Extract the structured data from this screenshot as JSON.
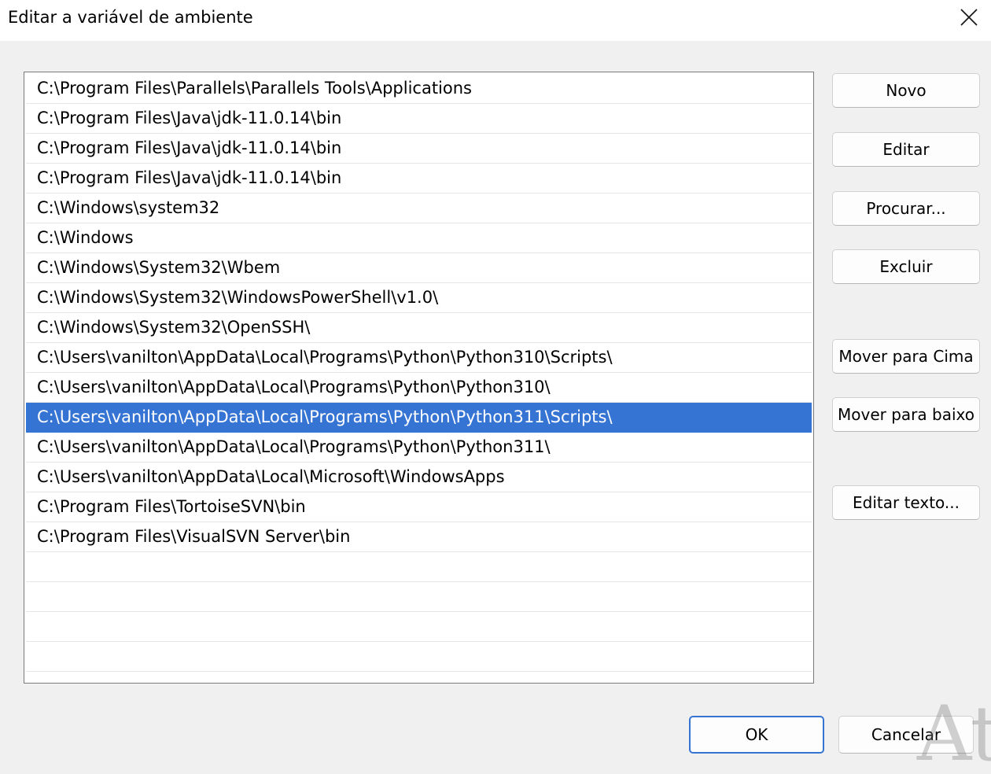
{
  "window": {
    "title": "Editar a variável de ambiente",
    "close_icon": "close-icon"
  },
  "paths": [
    "C:\\Program Files\\Parallels\\Parallels Tools\\Applications",
    "C:\\Program Files\\Java\\jdk-11.0.14\\bin",
    "C:\\Program Files\\Java\\jdk-11.0.14\\bin",
    "C:\\Program Files\\Java\\jdk-11.0.14\\bin",
    "C:\\Windows\\system32",
    "C:\\Windows",
    "C:\\Windows\\System32\\Wbem",
    "C:\\Windows\\System32\\WindowsPowerShell\\v1.0\\",
    "C:\\Windows\\System32\\OpenSSH\\",
    "C:\\Users\\vanilton\\AppData\\Local\\Programs\\Python\\Python310\\Scripts\\",
    "C:\\Users\\vanilton\\AppData\\Local\\Programs\\Python\\Python310\\",
    "C:\\Users\\vanilton\\AppData\\Local\\Programs\\Python\\Python311\\Scripts\\",
    "C:\\Users\\vanilton\\AppData\\Local\\Programs\\Python\\Python311\\",
    "C:\\Users\\vanilton\\AppData\\Local\\Microsoft\\WindowsApps",
    "C:\\Program Files\\TortoiseSVN\\bin",
    "C:\\Program Files\\VisualSVN Server\\bin",
    "",
    "",
    "",
    "",
    ""
  ],
  "selected_index": 11,
  "colors": {
    "selection": "#3574d3",
    "background": "#f0f0f0"
  },
  "buttons": {
    "new": "Novo",
    "edit": "Editar",
    "browse": "Procurar...",
    "delete": "Excluir",
    "move_up": "Mover para Cima",
    "move_down": "Mover para baixo",
    "edit_text": "Editar texto...",
    "ok": "OK",
    "cancel": "Cancelar"
  },
  "watermark": "At"
}
